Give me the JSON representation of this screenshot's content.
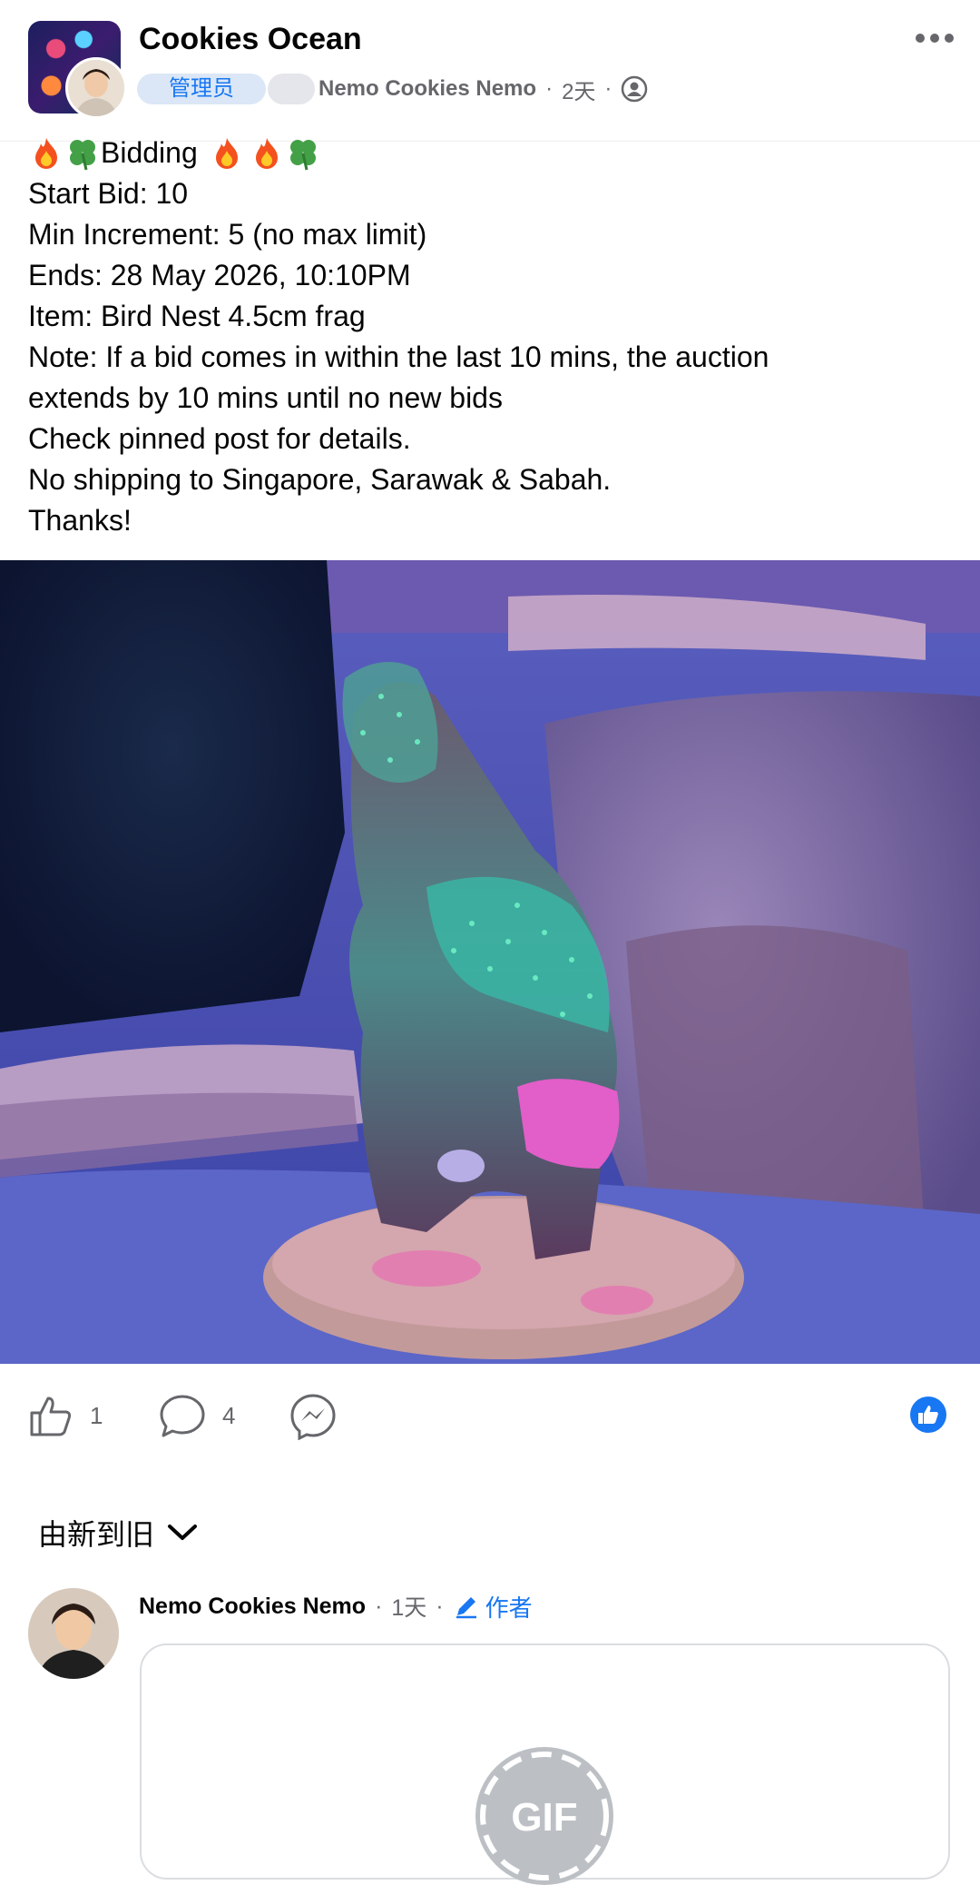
{
  "header": {
    "group_name": "Cookies Ocean",
    "role_badge": "管理员",
    "author_name": "Nemo Cookies Nemo",
    "time": "2天",
    "separator": "·",
    "icons": {
      "more": "more-horizontal-icon",
      "privacy": "group-privacy-icon"
    }
  },
  "post": {
    "title": "Bidding",
    "lines": [
      "Start Bid: 10",
      "Min Increment: 5 (no max limit)",
      "Ends: 28 May 2026, 10:10PM",
      "Item: Bird Nest 4.5cm frag",
      "Note: If a bid comes in within the last 10 mins, the auction",
      "extends by 10 mins until no new bids",
      "Check pinned post for details.",
      "No shipping to Singapore, Sarawak & Sabah.",
      "Thanks!"
    ]
  },
  "actions": {
    "like_count": "1",
    "comment_count": "4",
    "icons": [
      "like-icon",
      "comment-icon",
      "messenger-share-icon",
      "like-reaction-icon"
    ]
  },
  "comments": {
    "sort_label": "由新到旧",
    "items": [
      {
        "author": "Nemo Cookies Nemo",
        "time": "1天",
        "badge": "作者",
        "attachment": "GIF"
      }
    ]
  },
  "colors": {
    "accent": "#1877f2",
    "secondary_text": "#65676b",
    "badge_bg": "#dbe7f6"
  }
}
